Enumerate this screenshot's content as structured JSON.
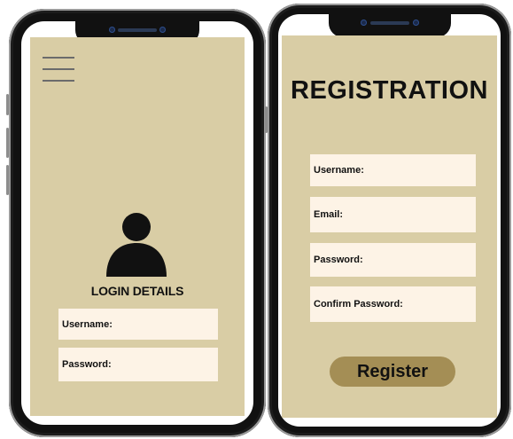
{
  "login_screen": {
    "title": "LOGIN DETAILS",
    "fields": [
      {
        "label": "Username:"
      },
      {
        "label": "Password:"
      }
    ],
    "icons": [
      "hamburger-menu-icon",
      "user-profile-icon"
    ]
  },
  "registration_screen": {
    "title": "REGISTRATION",
    "fields": [
      {
        "label": "Username:"
      },
      {
        "label": "Email:"
      },
      {
        "label": "Password:"
      },
      {
        "label": "Confirm Password:"
      }
    ],
    "register_label": "Register"
  },
  "colors": {
    "panel_background": "#d9cda5",
    "field_background": "#fdf3e6",
    "button_background": "#a48e55",
    "phone_frame": "#111111"
  }
}
